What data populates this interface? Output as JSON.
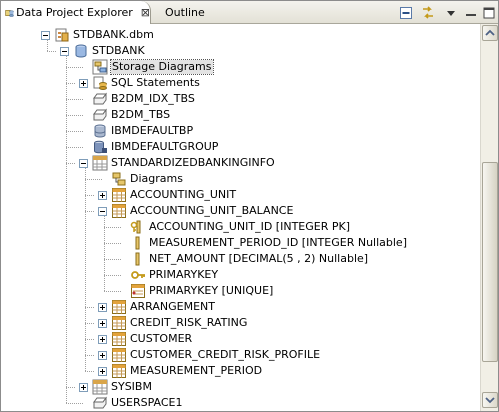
{
  "tabs": {
    "active_label": "Data Project Explorer",
    "inactive_label": "Outline",
    "close_glyph": "⊠"
  },
  "toolbar": {
    "buttons": [
      "collapse-all-icon",
      "link-with-editor-icon",
      "view-menu-icon"
    ]
  },
  "tree": [
    {
      "label": "STDBANK.dbm",
      "level": 0,
      "expander": "collapse",
      "icon": "dbm-file-icon"
    },
    {
      "label": "STDBANK",
      "level": 1,
      "expander": "collapse",
      "icon": "database-icon"
    },
    {
      "label": "Storage Diagrams",
      "level": 2,
      "expander": "",
      "icon": "storage-diagram-icon",
      "selected": true
    },
    {
      "label": "SQL Statements",
      "level": 2,
      "expander": "expand",
      "icon": "sql-statements-icon"
    },
    {
      "label": "B2DM_IDX_TBS",
      "level": 2,
      "expander": "",
      "icon": "tablespace-icon"
    },
    {
      "label": "B2DM_TBS",
      "level": 2,
      "expander": "",
      "icon": "tablespace-icon"
    },
    {
      "label": "IBMDEFAULTBP",
      "level": 2,
      "expander": "",
      "icon": "bufferpool-icon"
    },
    {
      "label": "IBMDEFAULTGROUP",
      "level": 2,
      "expander": "",
      "icon": "partition-group-icon"
    },
    {
      "label": "STANDARDIZEDBANKINGINFO",
      "level": 2,
      "expander": "collapse",
      "icon": "schema-icon"
    },
    {
      "label": "Diagrams",
      "level": 3,
      "expander": "",
      "icon": "diagram-icon"
    },
    {
      "label": "ACCOUNTING_UNIT",
      "level": 3,
      "expander": "expand",
      "icon": "table-icon"
    },
    {
      "label": "ACCOUNTING_UNIT_BALANCE",
      "level": 3,
      "expander": "collapse",
      "icon": "table-icon"
    },
    {
      "label": "ACCOUNTING_UNIT_ID [INTEGER PK]",
      "level": 4,
      "expander": "",
      "icon": "pk-column-icon"
    },
    {
      "label": "MEASUREMENT_PERIOD_ID [INTEGER Nullable]",
      "level": 4,
      "expander": "",
      "icon": "column-icon"
    },
    {
      "label": "NET_AMOUNT [DECIMAL(5 , 2) Nullable]",
      "level": 4,
      "expander": "",
      "icon": "column-icon"
    },
    {
      "label": "PRIMARYKEY",
      "level": 4,
      "expander": "",
      "icon": "key-icon"
    },
    {
      "label": "PRIMARYKEY [UNIQUE]",
      "level": 4,
      "expander": "",
      "icon": "index-icon"
    },
    {
      "label": "ARRANGEMENT",
      "level": 3,
      "expander": "expand",
      "icon": "table-icon"
    },
    {
      "label": "CREDIT_RISK_RATING",
      "level": 3,
      "expander": "expand",
      "icon": "table-icon"
    },
    {
      "label": "CUSTOMER",
      "level": 3,
      "expander": "expand",
      "icon": "table-icon"
    },
    {
      "label": "CUSTOMER_CREDIT_RISK_PROFILE",
      "level": 3,
      "expander": "expand",
      "icon": "table-icon"
    },
    {
      "label": "MEASUREMENT_PERIOD",
      "level": 3,
      "expander": "expand",
      "icon": "table-icon"
    },
    {
      "label": "SYSIBM",
      "level": 2,
      "expander": "expand",
      "icon": "schema-icon"
    },
    {
      "label": "USERSPACE1",
      "level": 2,
      "expander": "",
      "icon": "tablespace-icon"
    }
  ]
}
